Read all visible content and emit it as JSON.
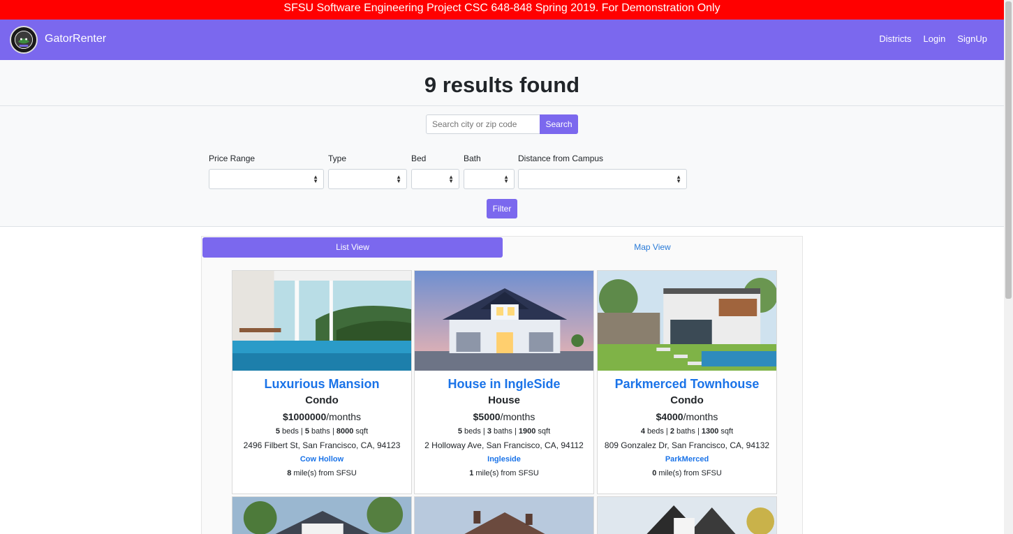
{
  "banner": {
    "text": "SFSU Software Engineering Project CSC 648-848 Spring 2019. For Demonstration Only"
  },
  "navbar": {
    "brand": "GatorRenter",
    "links": [
      {
        "label": "Districts"
      },
      {
        "label": "Login"
      },
      {
        "label": "SignUp"
      }
    ]
  },
  "results": {
    "title": "9 results found"
  },
  "search": {
    "placeholder": "Search city or zip code",
    "button_label": "Search"
  },
  "filters": {
    "price_label": "Price Range",
    "type_label": "Type",
    "bed_label": "Bed",
    "bath_label": "Bath",
    "distance_label": "Distance from Campus",
    "button_label": "Filter"
  },
  "tabs": {
    "list": "List View",
    "map": "Map View"
  },
  "listings": [
    {
      "title": "Luxurious Mansion",
      "type": "Condo",
      "price": "$1000000",
      "price_unit": "/months",
      "beds": "5",
      "baths": "5",
      "sqft": "8000",
      "address": "2496 Filbert St, San Francisco, CA, 94123",
      "district": "Cow Hollow",
      "distance": "8"
    },
    {
      "title": "House in IngleSide",
      "type": "House",
      "price": "$5000",
      "price_unit": "/months",
      "beds": "5",
      "baths": "3",
      "sqft": "1900",
      "address": "2 Holloway Ave, San Francisco, CA, 94112",
      "district": "Ingleside",
      "distance": "1"
    },
    {
      "title": "Parkmerced Townhouse",
      "type": "Condo",
      "price": "$4000",
      "price_unit": "/months",
      "beds": "4",
      "baths": "2",
      "sqft": "1300",
      "address": "809 Gonzalez Dr, San Francisco, CA, 94132",
      "district": "ParkMerced",
      "distance": "0"
    }
  ],
  "listing_text": {
    "beds": " beds | ",
    "baths": " baths | ",
    "sqft": " sqft",
    "distance_suffix": " mile(s) from SFSU"
  },
  "colors": {
    "accent": "#7b68ee",
    "banner": "#ff0000",
    "link": "#1a73e8"
  },
  "icons": {
    "select_arrow": "sort-arrows-icon",
    "logo": "gator-logo-icon"
  }
}
